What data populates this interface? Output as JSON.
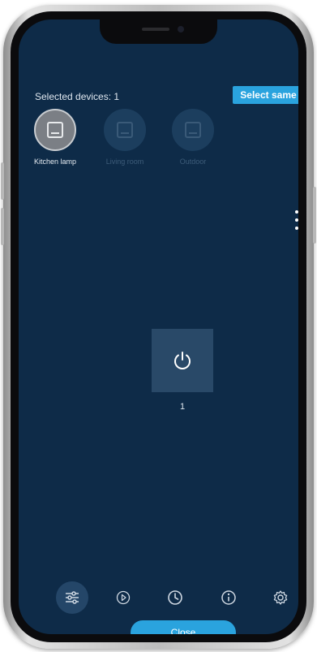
{
  "header": {
    "selected_text": "Selected devices: 1",
    "select_same_label": "Select same"
  },
  "devices": [
    {
      "label": "Kitchen lamp",
      "selected": true
    },
    {
      "label": "Living room",
      "selected": false
    },
    {
      "label": "Outdoor",
      "selected": false
    }
  ],
  "main": {
    "power_value": "1"
  },
  "bottom_nav": {
    "items": [
      {
        "icon": "sliders-icon",
        "active": true
      },
      {
        "icon": "play-icon",
        "active": false
      },
      {
        "icon": "clock-icon",
        "active": false
      },
      {
        "icon": "info-icon",
        "active": false
      },
      {
        "icon": "gear-icon",
        "active": false
      }
    ],
    "close_label": "Close"
  },
  "colors": {
    "background": "#0e2b48",
    "accent": "#2aa3de",
    "tile": "#294968"
  }
}
